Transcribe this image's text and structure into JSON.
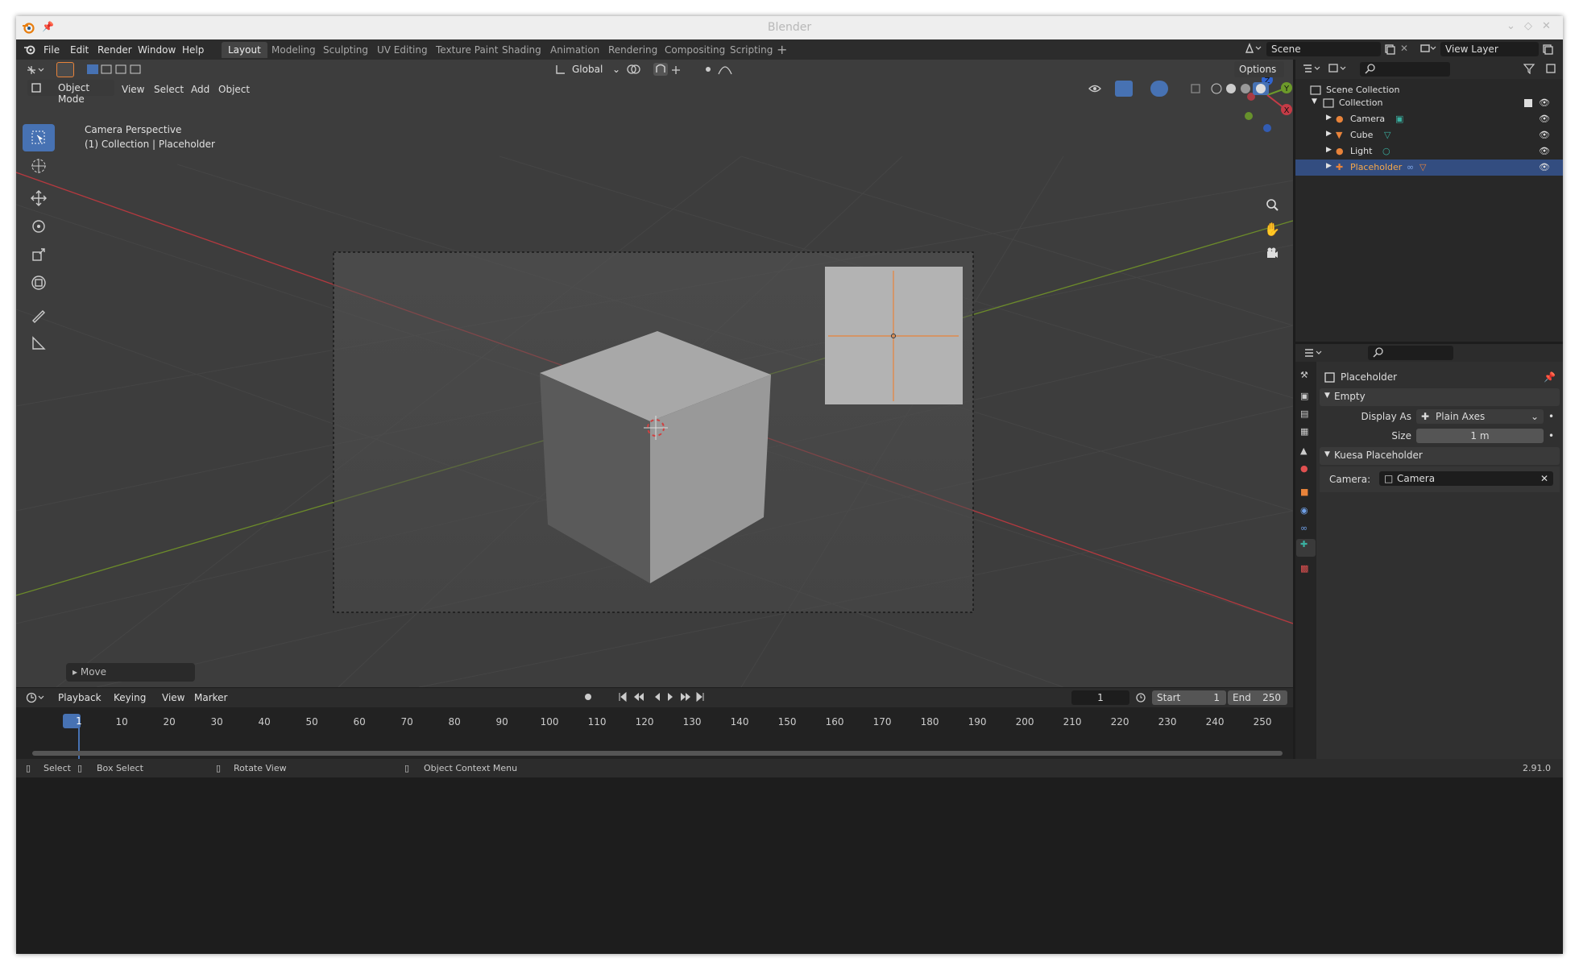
{
  "window": {
    "title": "Blender"
  },
  "menu": [
    "File",
    "Edit",
    "Render",
    "Window",
    "Help"
  ],
  "workspaces": [
    {
      "label": "Layout",
      "active": true
    },
    {
      "label": "Modeling"
    },
    {
      "label": "Sculpting"
    },
    {
      "label": "UV Editing"
    },
    {
      "label": "Texture Paint"
    },
    {
      "label": "Shading"
    },
    {
      "label": "Animation"
    },
    {
      "label": "Rendering"
    },
    {
      "label": "Compositing"
    },
    {
      "label": "Scripting"
    }
  ],
  "scene": {
    "name": "Scene",
    "view_layer": "View Layer"
  },
  "viewport": {
    "orientation": "Global",
    "options_label": "Options",
    "mode": "Object Mode",
    "menus": [
      "View",
      "Select",
      "Add",
      "Object"
    ],
    "info_line1": "Camera Perspective",
    "info_line2": "(1) Collection | Placeholder",
    "last_op": "Move"
  },
  "gizmo": {
    "x": "X",
    "y": "Y",
    "z": "Z"
  },
  "outliner": {
    "root": "Scene Collection",
    "collection": "Collection",
    "objects": [
      {
        "name": "Camera",
        "color": "#e8833a",
        "selected": false
      },
      {
        "name": "Cube",
        "color": "#e8833a",
        "selected": false
      },
      {
        "name": "Light",
        "color": "#e8833a",
        "selected": false
      },
      {
        "name": "Placeholder",
        "color": "#e8833a",
        "selected": true
      }
    ]
  },
  "properties": {
    "object_name": "Placeholder",
    "empty_panel": "Empty",
    "display_as_label": "Display As",
    "display_as_value": "Plain Axes",
    "size_label": "Size",
    "size_value": "1 m",
    "addon_panel": "Kuesa Placeholder",
    "camera_label": "Camera:",
    "camera_value": "Camera"
  },
  "timeline": {
    "menus": [
      "Playback",
      "Keying",
      "View",
      "Marker"
    ],
    "current_frame": "1",
    "start_label": "Start",
    "start_value": "1",
    "end_label": "End",
    "end_value": "250",
    "ticks": [
      "1",
      "10",
      "20",
      "30",
      "40",
      "50",
      "60",
      "70",
      "80",
      "90",
      "100",
      "110",
      "120",
      "130",
      "140",
      "150",
      "160",
      "170",
      "180",
      "190",
      "200",
      "210",
      "220",
      "230",
      "240",
      "250"
    ]
  },
  "statusbar": {
    "select": "Select",
    "box_select": "Box Select",
    "rotate_view": "Rotate View",
    "context_menu": "Object Context Menu",
    "version": "2.91.0"
  },
  "colors": {
    "accent": "#4772b3",
    "selection": "#334d80",
    "object_orange": "#e8833a",
    "x_axis": "#b5393f",
    "y_axis": "#6c8b2a"
  }
}
